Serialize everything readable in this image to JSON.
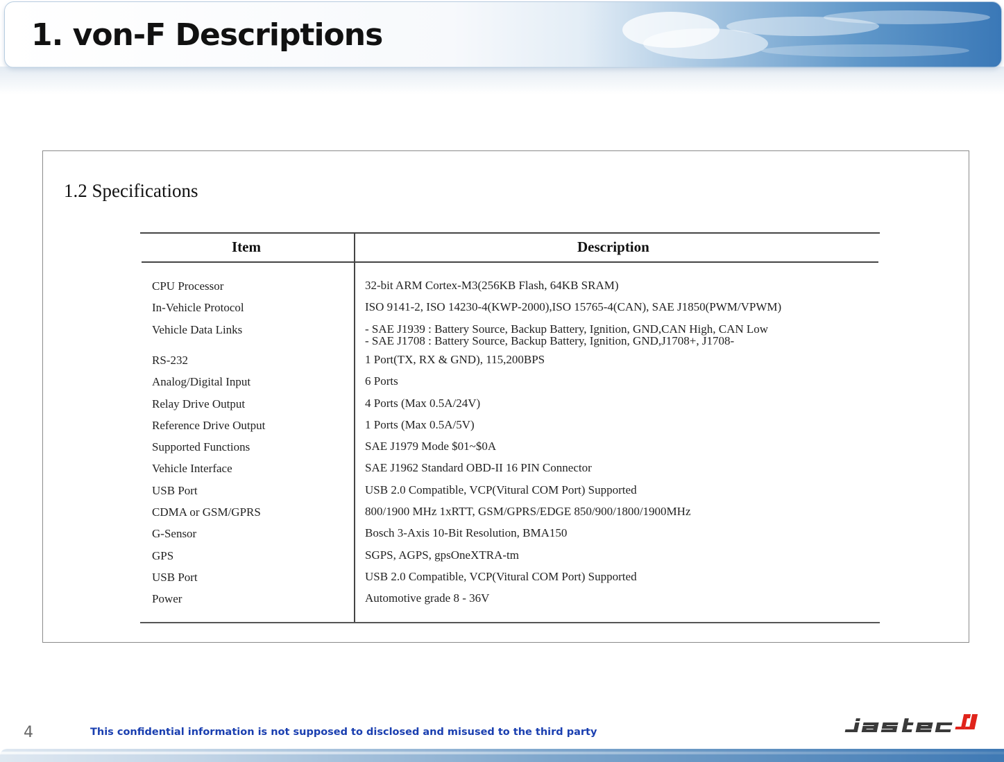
{
  "header": {
    "title": "1. von-F Descriptions"
  },
  "section_title": "1.2 Specifications",
  "table": {
    "headers": {
      "item": "Item",
      "description": "Description"
    },
    "rows": [
      {
        "item": "CPU Processor",
        "description": [
          "32-bit ARM Cortex-M3(256KB Flash, 64KB SRAM)"
        ]
      },
      {
        "item": "In-Vehicle Protocol",
        "description": [
          "ISO 9141-2, ISO 14230-4(KWP-2000),ISO 15765-4(CAN), SAE J1850(PWM/VPWM)"
        ]
      },
      {
        "item": "Vehicle Data Links",
        "description": [
          "- SAE J1939 : Battery Source, Backup Battery, Ignition, GND,CAN High, CAN Low",
          "- SAE J1708 : Battery Source, Backup Battery, Ignition, GND,J1708+, J1708-"
        ]
      },
      {
        "item": "RS-232",
        "description": [
          "1 Port(TX, RX & GND), 115,200BPS"
        ]
      },
      {
        "item": "Analog/Digital Input",
        "description": [
          "6 Ports"
        ]
      },
      {
        "item": "Relay Drive Output",
        "description": [
          "4 Ports (Max 0.5A/24V)"
        ]
      },
      {
        "item": "Reference Drive Output",
        "description": [
          "1 Ports (Max 0.5A/5V)"
        ]
      },
      {
        "item": "Supported Functions",
        "description": [
          "SAE J1979 Mode $01~$0A"
        ]
      },
      {
        "item": "Vehicle Interface",
        "description": [
          "SAE J1962 Standard OBD-II 16 PIN Connector"
        ]
      },
      {
        "item": "USB Port",
        "description": [
          "USB 2.0 Compatible, VCP(Vitural COM Port) Supported"
        ]
      },
      {
        "item": "CDMA or GSM/GPRS",
        "description": [
          "800/1900 MHz 1xRTT, GSM/GPRS/EDGE 850/900/1800/1900MHz"
        ]
      },
      {
        "item": "G-Sensor",
        "description": [
          "Bosch 3-Axis 10-Bit Resolution, BMA150"
        ]
      },
      {
        "item": "GPS",
        "description": [
          "SGPS, AGPS, gpsOneXTRA-tm"
        ]
      },
      {
        "item": "USB Port",
        "description": [
          "USB 2.0 Compatible, VCP(Vitural COM Port) Supported"
        ]
      },
      {
        "item": "Power",
        "description": [
          "Automotive grade 8 - 36V"
        ]
      }
    ]
  },
  "footer": {
    "page_number": "4",
    "confidential_notice": "This confidential information is not supposed to disclosed and misused to the third party",
    "logo_text": "jastec"
  },
  "colors": {
    "notice_text": "#1a3fb0",
    "logo_red": "#e0241b",
    "logo_gray": "#3a3a3a",
    "banner_blue": "#3a78b7"
  }
}
